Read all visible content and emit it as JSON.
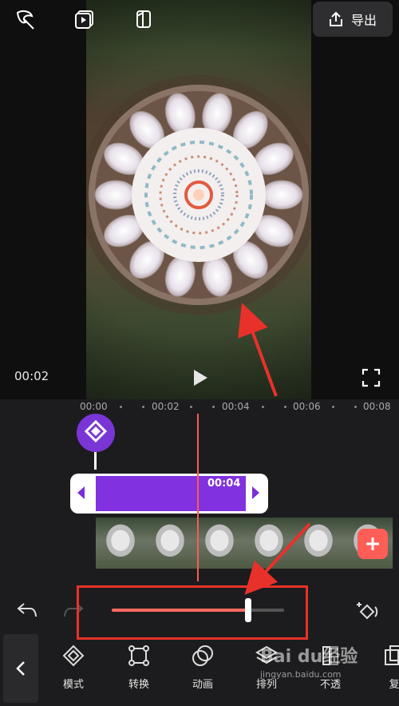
{
  "topbar": {
    "export_label": "导出"
  },
  "preview": {
    "current_time": "00:02"
  },
  "ruler": {
    "ticks": [
      "00:00",
      "00:02",
      "00:04",
      "00:06",
      "00:08"
    ]
  },
  "clip": {
    "duration_label": "00:04"
  },
  "slider": {
    "value": 0.79
  },
  "toolbar": {
    "items": [
      {
        "label": "模式",
        "icon": "mode-icon"
      },
      {
        "label": "转换",
        "icon": "transform-icon"
      },
      {
        "label": "动画",
        "icon": "animation-icon"
      },
      {
        "label": "排列",
        "icon": "layers-icon"
      },
      {
        "label": "不透",
        "icon": "opacity-icon"
      },
      {
        "label": "复",
        "icon": "copy-icon"
      }
    ]
  },
  "watermark": {
    "text": "Bai du经验",
    "sub": "jingyan.baidu.com"
  },
  "colors": {
    "accent": "#8131e0",
    "playhead": "#ff5a52",
    "highlight": "#e8312a",
    "add": "#ff5e57"
  }
}
